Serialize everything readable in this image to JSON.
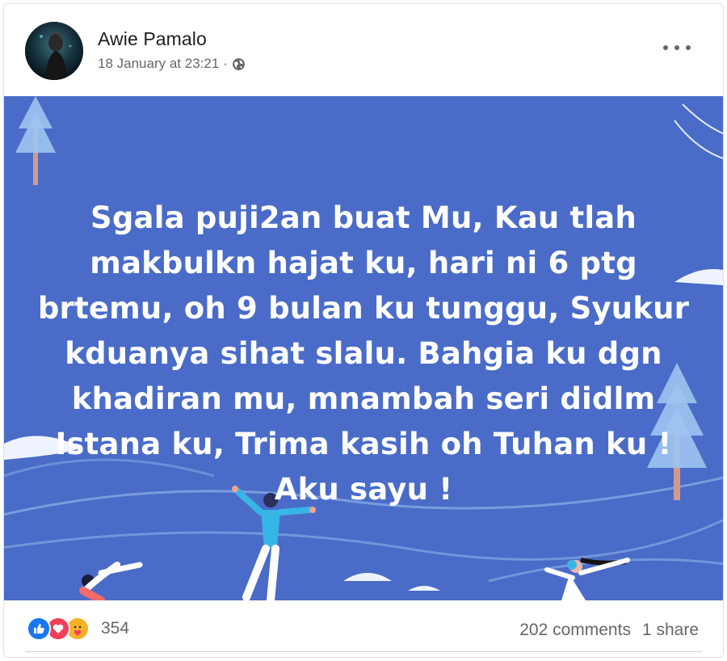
{
  "post": {
    "author": "Awie Pamalo",
    "timestamp": "18 January at 23:21",
    "separator": "·",
    "privacy_icon": "globe-icon",
    "more_icon": "more-options-icon",
    "text_lines": [
      "Sgala puji2an buat Mu, Kau tlah",
      "makbulkn hajat ku, hari ni 6 ptg",
      "brtemu, oh 9 bulan ku tunggu, Syukur",
      "kduanya sihat slalu. Bahgia ku dgn",
      "khadiran mu, mnambah seri didlm",
      "Istana ku, Trima kasih oh Tuhan ku !",
      "Aku sayu !"
    ],
    "background_color": "#4a6cc8"
  },
  "footer": {
    "reaction_icons": [
      "like-icon",
      "love-icon",
      "care-icon"
    ],
    "reaction_count": "354",
    "comments": "202 comments",
    "shares": "1 share"
  }
}
